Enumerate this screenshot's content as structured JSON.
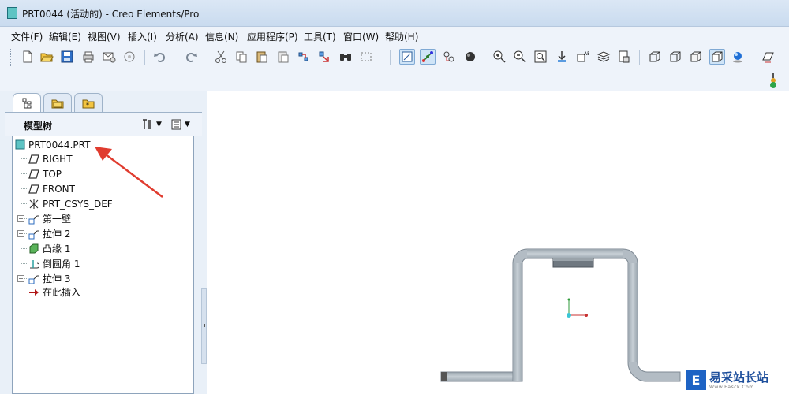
{
  "window": {
    "title": "PRT0044 (活动的) - Creo Elements/Pro",
    "icon": "part-icon"
  },
  "menu": [
    "文件(F)",
    "编辑(E)",
    "视图(V)",
    "插入(I)",
    "分析(A)",
    "信息(N)",
    "应用程序(P)",
    "工具(T)",
    "窗口(W)",
    "帮助(H)"
  ],
  "toolbar_icons": [
    "new-file-icon",
    "open-folder-icon",
    "save-icon",
    "print-icon",
    "email-icon",
    "email-attach-icon",
    "undo-icon",
    "redo-icon",
    "cut-icon",
    "copy-icon",
    "paste-icon",
    "paste-special-icon",
    "regenerate-icon",
    "regenerate-manager-icon",
    "find-icon",
    "select-box-icon",
    "repaint-icon",
    "spin-center-icon",
    "orient-icon",
    "shading-icon",
    "zoom-in-icon",
    "zoom-out-icon",
    "refit-icon",
    "datum-display-icon",
    "annotation-icon",
    "layers-icon",
    "view-manager-icon",
    "wireframe-icon",
    "hidden-line-icon",
    "no-hidden-icon",
    "shaded-icon",
    "enhanced-realism-icon",
    "sketch-icon"
  ],
  "panel": {
    "title": "模型树",
    "tabs": [
      "model-tree-tab-icon",
      "folder-browser-tab-icon",
      "favorites-tab-icon"
    ]
  },
  "tree": {
    "root": "PRT0044.PRT",
    "items": [
      {
        "label": "RIGHT",
        "icon": "datum-plane-icon",
        "expandable": false
      },
      {
        "label": "TOP",
        "icon": "datum-plane-icon",
        "expandable": false
      },
      {
        "label": "FRONT",
        "icon": "datum-plane-icon",
        "expandable": false
      },
      {
        "label": "PRT_CSYS_DEF",
        "icon": "csys-icon",
        "expandable": false
      },
      {
        "label": "第一壁",
        "icon": "sheetmetal-wall-icon",
        "expandable": true
      },
      {
        "label": "拉伸 2",
        "icon": "extrude-icon",
        "expandable": true
      },
      {
        "label": "凸缘 1",
        "icon": "flange-icon",
        "expandable": false
      },
      {
        "label": "倒圆角 1",
        "icon": "round-icon",
        "expandable": false
      },
      {
        "label": "拉伸 3",
        "icon": "extrude-icon",
        "expandable": true
      },
      {
        "label": "在此插入",
        "icon": "insert-here-icon",
        "expandable": false
      }
    ]
  },
  "watermark": {
    "text": "易采站长站",
    "sub": "Www.Easck.Com",
    "logo": "E"
  },
  "colors": {
    "part": "#b3bcc4",
    "part_edge": "#7f8a94",
    "arrow": "#e03c2f",
    "accent": "#1e63c4"
  }
}
